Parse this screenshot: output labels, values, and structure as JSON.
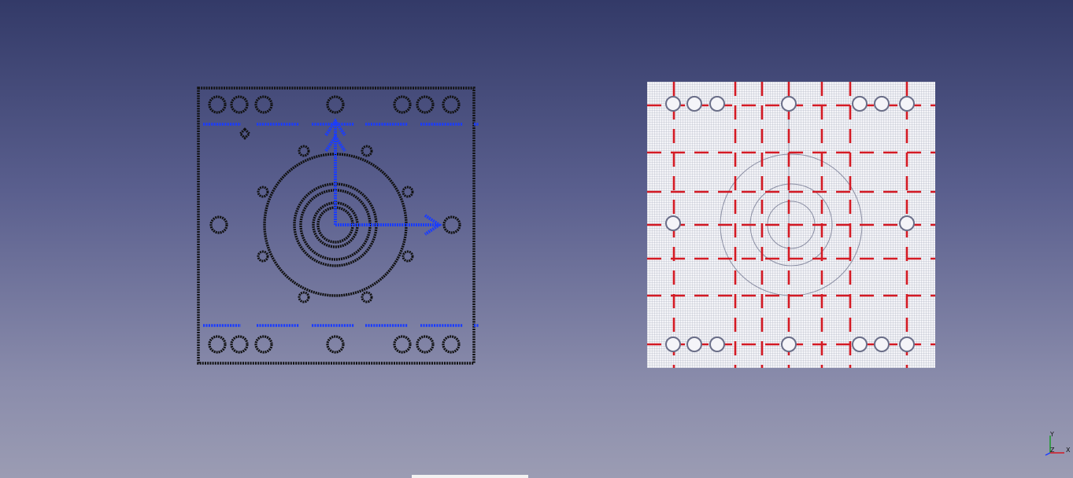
{
  "viewport": {
    "background_top": "#333a68",
    "background_bottom": "#9b9cb3"
  },
  "sketch_model": {
    "line_color": "#111111",
    "construction_color": "#1a3cff"
  },
  "meshed_model": {
    "fill_color": "#f4f4f8",
    "mesh_color": "#9ea2b4",
    "boundary_color": "#d41a24"
  },
  "axis_indicator": {
    "x_label": "X",
    "y_label": "Y",
    "z_label": "Z",
    "x_color": "#d41a24",
    "y_color": "#1a9a2a",
    "z_color": "#1a3cff"
  }
}
